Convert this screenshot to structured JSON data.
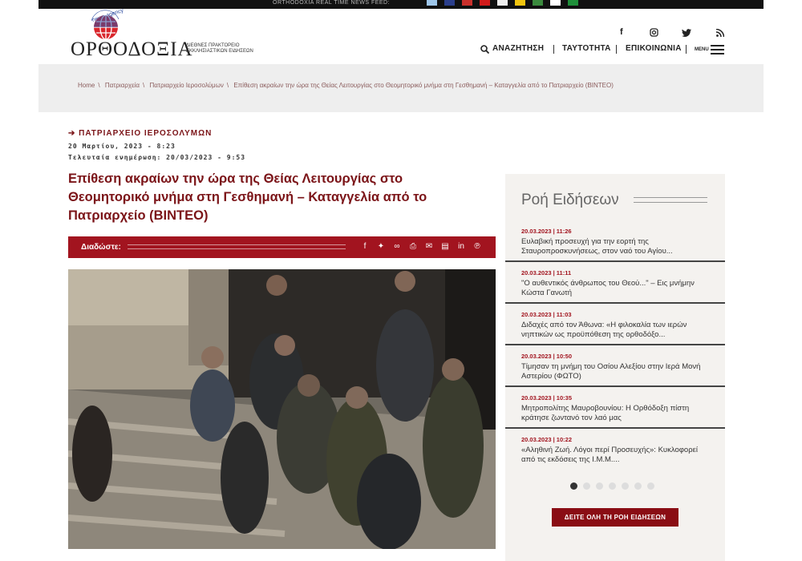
{
  "topbar": {
    "feed_label": "ORTHODOXIA REAL TIME NEWS FEED:"
  },
  "colors": {
    "accent": "#a2141f",
    "title": "#7b1418",
    "sidebar_bg": "#f4f2ef"
  },
  "logo": {
    "arc_text": "news agency",
    "name": "ΟΡΘΟΔΟΞΙΑ",
    "subtitle": "ΔΙΕΘΝΕΣ ΠΡΑΚΤΟΡΕΙΟ ΕΚΚΛΗΣΙΑΣΤΙΚΩΝ ΕΙΔΗΣΕΩΝ"
  },
  "header": {
    "social_icons": [
      "facebook-icon",
      "instagram-icon",
      "twitter-icon",
      "rss-icon"
    ],
    "search_label": "ΑΝΑΖΗΤΗΣΗ",
    "identity_label": "ΤΑΥΤΟΤΗΤΑ",
    "contact_label": "ΕΠΙΚΟΙΝΩΝΙΑ",
    "menu_label": "MENU"
  },
  "breadcrumb": {
    "items": [
      "Home",
      "Πατριαρχεία",
      "Πατριαρχείο Ιεροσολύμων",
      "Επίθεση ακραίων την ώρα της Θείας Λειτουργίας στο Θεομητορικό μνήμα στη Γεσθημανή – Καταγγελία από το Πατριαρχείο (ΒΙΝΤΕΟ)"
    ]
  },
  "article": {
    "category": "ΠΑΤΡΙΑΡΧΕΙΟ ΙΕΡΟΣΟΛΥΜΩΝ",
    "published": "20 Μαρτίου, 2023 - 8:23",
    "updated": "Τελευταία ενημέρωση: 20/03/2023 - 9:53",
    "title": "Επίθεση ακραίων την ώρα της Θείας Λειτουργίας στο Θεομητορικό μνήμα στη Γεσθημανή – Καταγγελία από το Πατριαρχείο (ΒΙΝΤΕΟ)",
    "share_label": "Διαδώστε:",
    "share_icons": [
      "facebook-icon",
      "twitter-icon",
      "link-icon",
      "print-icon",
      "email-icon",
      "pdf-icon",
      "linkedin-icon",
      "pinterest-icon"
    ]
  },
  "sidebar": {
    "title": "Ροή Ειδήσεων",
    "items": [
      {
        "date": "20.03.2023 | 11:26",
        "text": "Ευλαβική προσευχή για την εορτή της Σταυροπροσκυνήσεως, στον ναό του Αγίου..."
      },
      {
        "date": "20.03.2023 | 11:11",
        "text": "\"Ο αυθεντικός άνθρωπος του Θεού...\" – Εις μνήμην Κώστα Γανωτή"
      },
      {
        "date": "20.03.2023 | 11:03",
        "text": "Διδαχές από τον Άθωνα: «Η φιλοκαλία των ιερών νηπτικών ως προϋπόθεση της ορθοδόξο..."
      },
      {
        "date": "20.03.2023 | 10:50",
        "text": "Τίμησαν τη μνήμη του Οσίου Αλεξίου στην Ιερά Μονή Αστερίου (ΦΩΤΟ)"
      },
      {
        "date": "20.03.2023 | 10:35",
        "text": "Μητροπολίτης Μαυροβουνίου: Η Ορθόδοξη πίστη κράτησε ζωντανό τον λαό μας"
      },
      {
        "date": "20.03.2023 | 10:22",
        "text": "«Αληθινή Ζωή. Λόγοι περί Προσευχής»: Κυκλοφορεί από τις εκδόσεις της Ι.Μ.Μ...."
      }
    ],
    "pager_pages": 7,
    "pager_active": 1,
    "all_news_button": "ΔΕΙΤΕ ΟΛΗ ΤΗ ΡΟΗ ΕΙΔΗΣΕΩΝ"
  }
}
